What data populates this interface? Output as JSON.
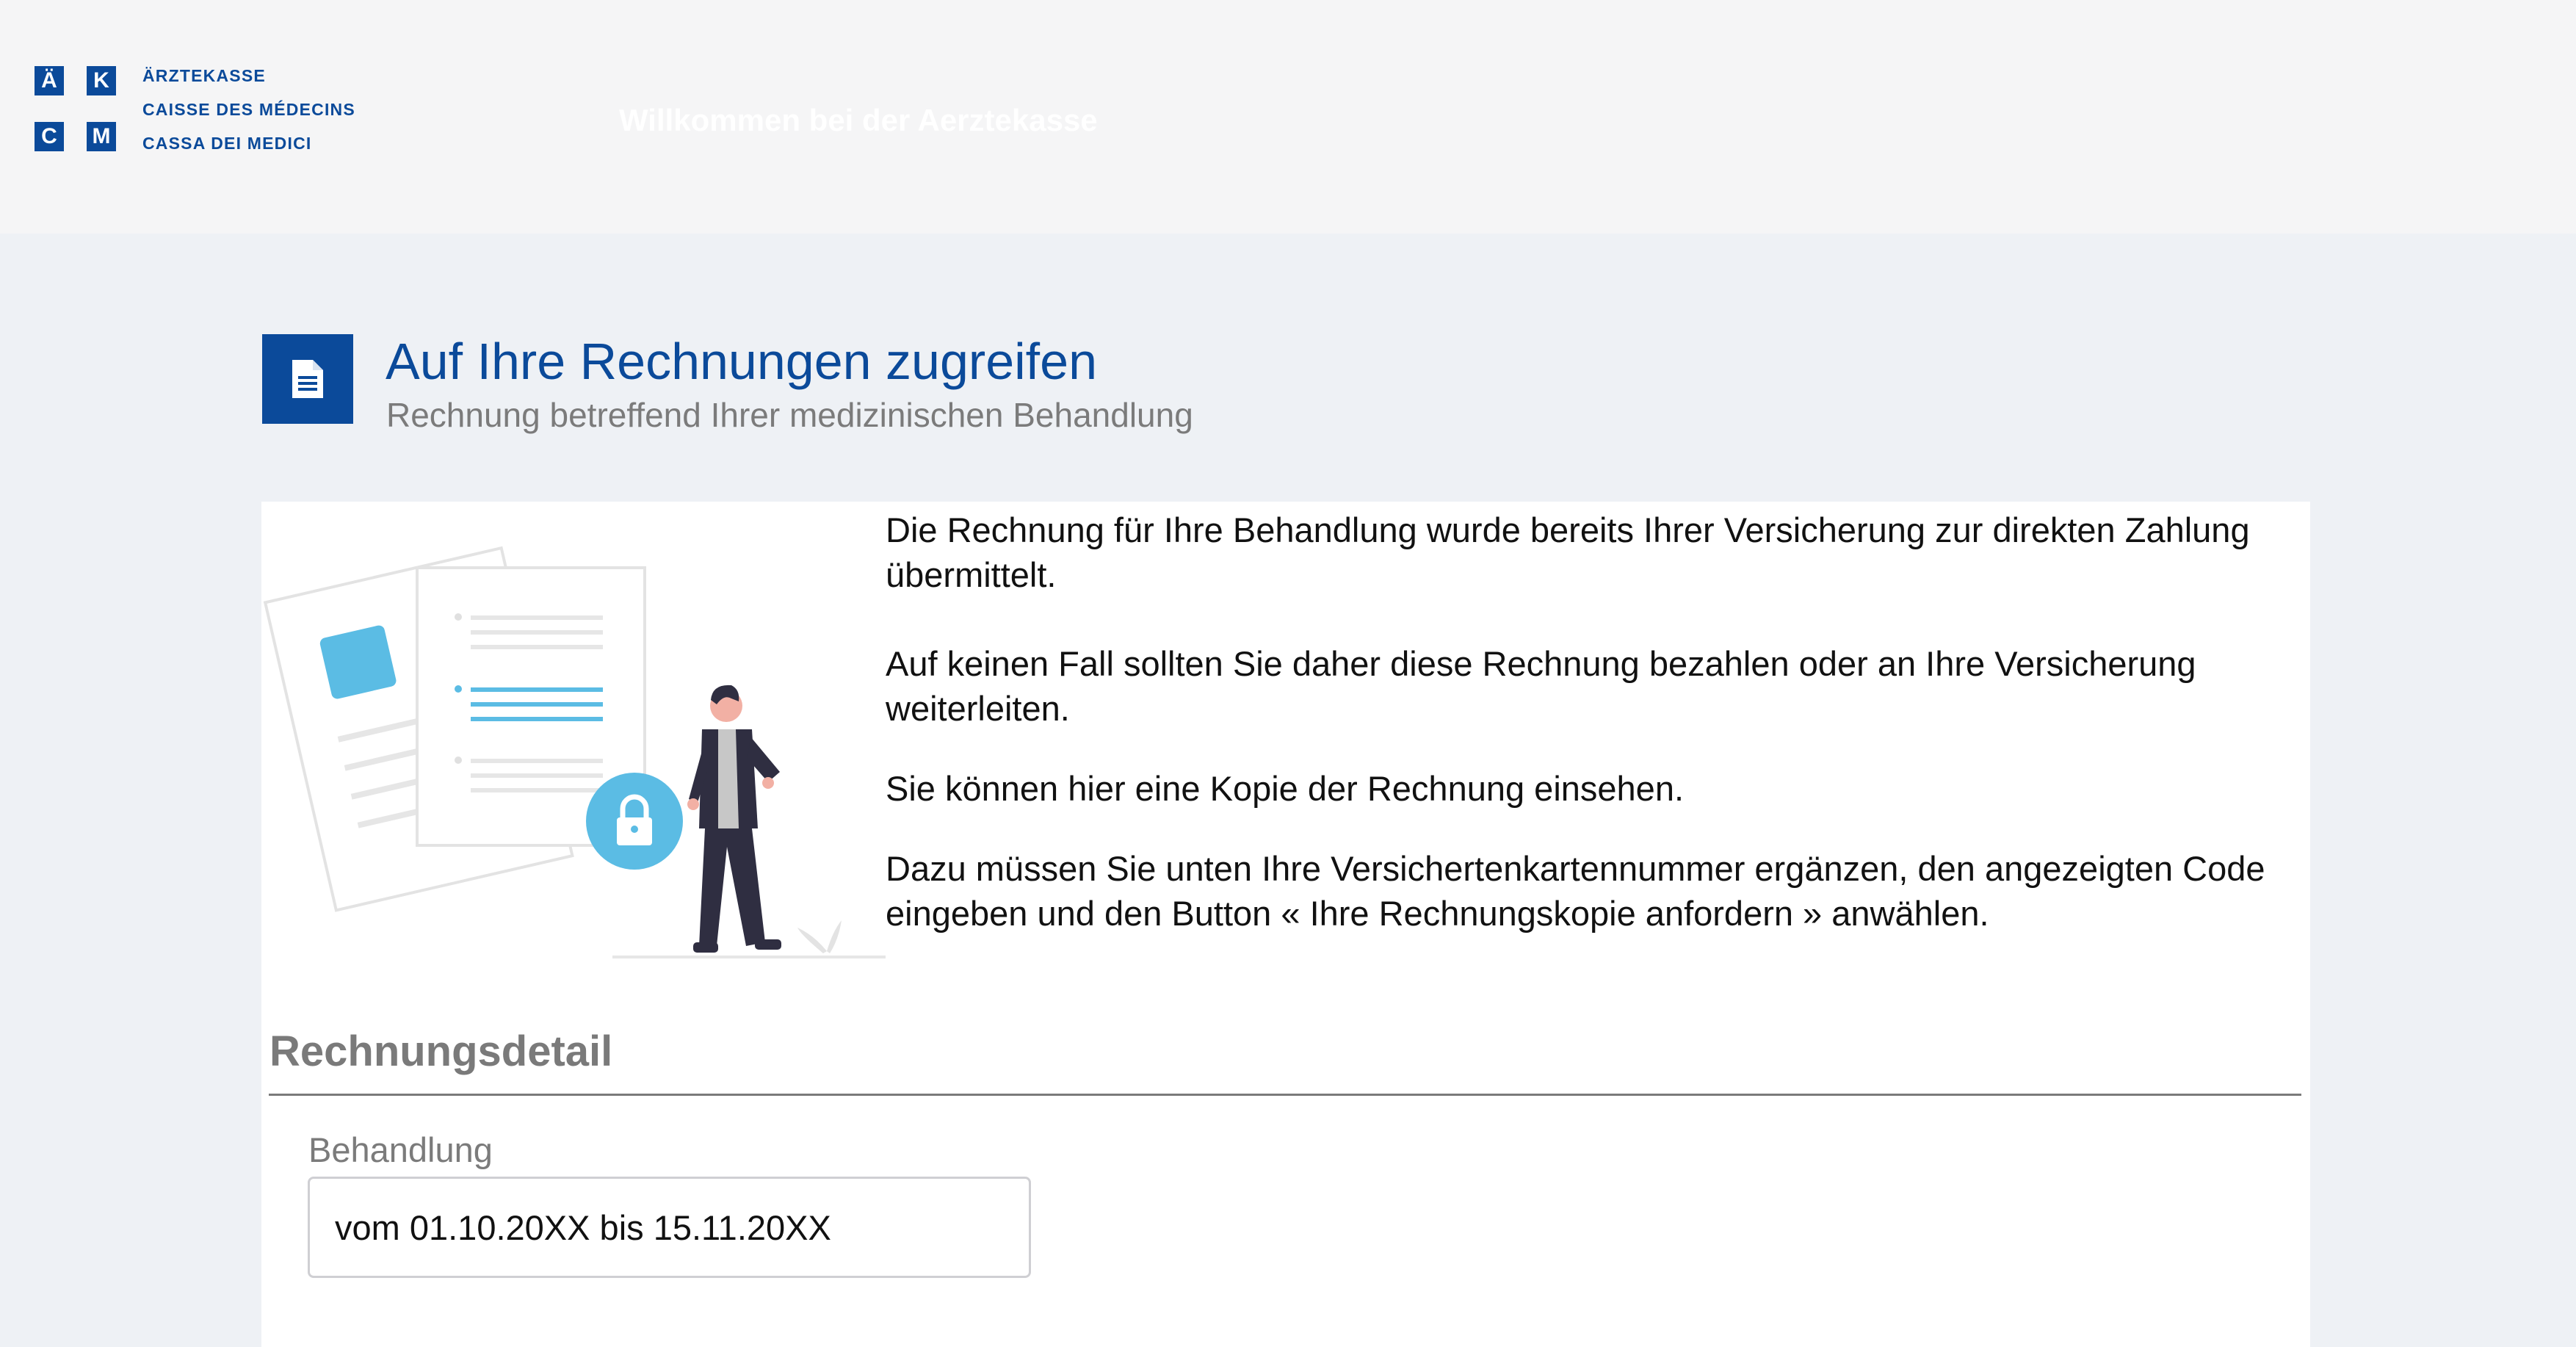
{
  "header": {
    "logo_letters": [
      "Ä",
      "K",
      "C",
      "M"
    ],
    "logo_lines": [
      "ÄRZTEKASSE",
      "CAISSE DES MÉDECINS",
      "CASSA DEI MEDICI"
    ],
    "welcome": "Willkommen bei der Aerztekasse"
  },
  "page": {
    "icon": "document-icon",
    "title": "Auf Ihre Rechnungen zugreifen",
    "subtitle": "Rechnung betreffend Ihrer medizinischen Behandlung"
  },
  "info": {
    "paragraphs": [
      "Die Rechnung für Ihre Behandlung wurde bereits Ihrer Versicherung zur direkten Zahlung übermittelt.",
      "Auf keinen Fall sollten Sie daher diese Rechnung bezahlen oder an Ihre Versicherung weiterleiten.",
      "Sie können hier eine Kopie der Rechnung einsehen.",
      "Dazu müssen Sie unten Ihre Versichertenkartennummer ergänzen, den angezeigten Code eingeben und den Button « Ihre Rechnungskopie anfordern » anwählen."
    ]
  },
  "details": {
    "section_title": "Rechnungsdetail",
    "treatment_label": "Behandlung",
    "treatment_value": "vom 01.10.20XX bis 15.11.20XX"
  },
  "colors": {
    "brand": "#0b4a9a",
    "accent": "#5bbce4",
    "background": "#eef1f5",
    "header": "#f5f5f6"
  }
}
